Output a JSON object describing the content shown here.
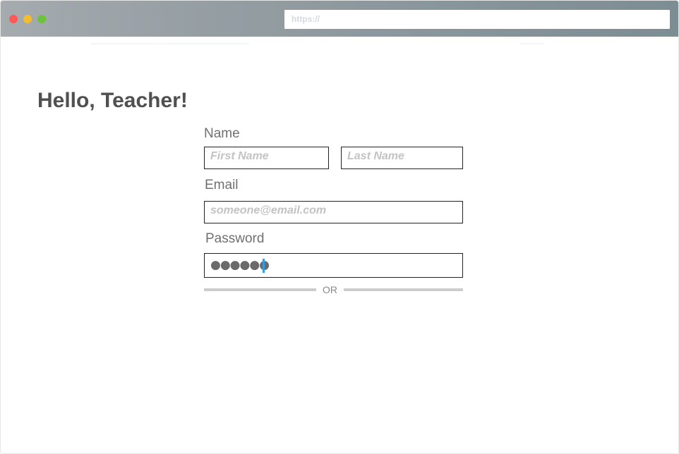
{
  "browser": {
    "url_placeholder": "https://",
    "window_controls": [
      "close",
      "minimize",
      "maximize"
    ]
  },
  "page": {
    "heading": "Hello, Teacher!"
  },
  "form": {
    "name_label": "Name",
    "first_name": {
      "value": "",
      "placeholder": "First Name"
    },
    "last_name": {
      "value": "",
      "placeholder": "Last Name"
    },
    "email_label": "Email",
    "email": {
      "value": "",
      "placeholder": "someone@email.com"
    },
    "password_label": "Password",
    "password": {
      "masked": "●●●●●●",
      "length": 6,
      "focused": true
    },
    "divider_text": "OR"
  },
  "colors": {
    "heading": "#505050",
    "label": "#707070",
    "placeholder": "#c3c3c3",
    "caret": "#2f9fe3",
    "divider": "#cccccc",
    "close": "#fb5a57",
    "minimize": "#f4bd2f",
    "maximize": "#6ac33a"
  }
}
